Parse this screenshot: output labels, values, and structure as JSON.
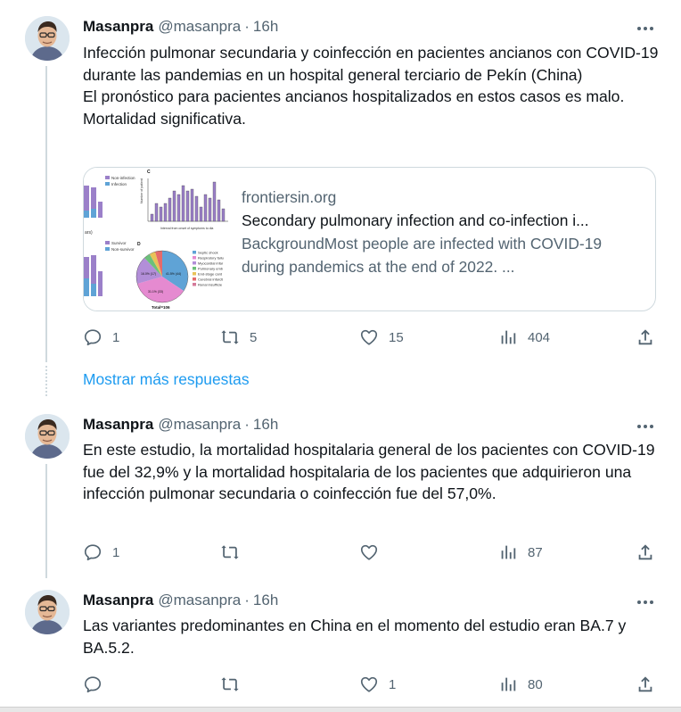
{
  "colors": {
    "text": "#0f1419",
    "muted": "#536471",
    "link": "#1d9bf0",
    "border": "#cfd9de"
  },
  "tweets": [
    {
      "name": "Masanpra",
      "handle": "@masanpra",
      "separator": "·",
      "time": "16h",
      "lines": [
        "Infección pulmonar secundaria y coinfección en pacientes ancianos con COVID-19 durante las pandemias en un hospital general terciario de Pekín (China)",
        "El pronóstico para pacientes ancianos hospitalizados en estos casos es malo. Mortalidad significativa."
      ],
      "card": {
        "domain": "frontiersin.org",
        "title": "Secondary pulmonary infection and co-infection i...",
        "description": "BackgroundMost people are infected with COVID-19 during pandemics at the end of 2022. ...",
        "figure": {
          "legend_top": [
            "Non-infection",
            "Infection"
          ],
          "legend_mid": [
            "Survivor",
            "Non-survivor"
          ],
          "panel_c": "C",
          "panel_d": "D",
          "c_ylabel": "Number of patient",
          "c_xlabel": "Interval from onset of symptoms to dia",
          "pie_legend": [
            "Septic shock",
            "Respiratory failu",
            "Myocardial infar",
            "Pulmonary emb",
            "End-stage card",
            "Cerebral infarcti",
            "Renal insufficie"
          ],
          "pie_labels": [
            "41.5% (44)",
            "31.1% (33)",
            "16.0% (17)"
          ],
          "total": "Total=106",
          "left_tag": "ars)"
        }
      },
      "stats": {
        "replies": "1",
        "retweets": "5",
        "likes": "15",
        "views": "404"
      }
    },
    {
      "name": "Masanpra",
      "handle": "@masanpra",
      "separator": "·",
      "time": "16h",
      "lines": [
        "En este estudio, la mortalidad hospitalaria general de los pacientes con COVID-19 fue del 32,9% y la mortalidad hospitalaria de los pacientes que adquirieron una infección pulmonar secundaria o coinfección fue del 57,0%."
      ],
      "stats": {
        "replies": "1",
        "retweets": "",
        "likes": "",
        "views": "87"
      }
    },
    {
      "name": "Masanpra",
      "handle": "@masanpra",
      "separator": "·",
      "time": "16h",
      "lines": [
        "Las variantes predominantes en China en el momento del estudio eran BA.7 y BA.5.2."
      ],
      "stats": {
        "replies": "",
        "retweets": "",
        "likes": "1",
        "views": "80"
      }
    }
  ],
  "show_more": "Mostrar más respuestas",
  "icons": {
    "reply": "reply-icon",
    "retweet": "retweet-icon",
    "like": "heart-icon",
    "views": "views-icon",
    "share": "share-icon",
    "more": "more-icon"
  }
}
